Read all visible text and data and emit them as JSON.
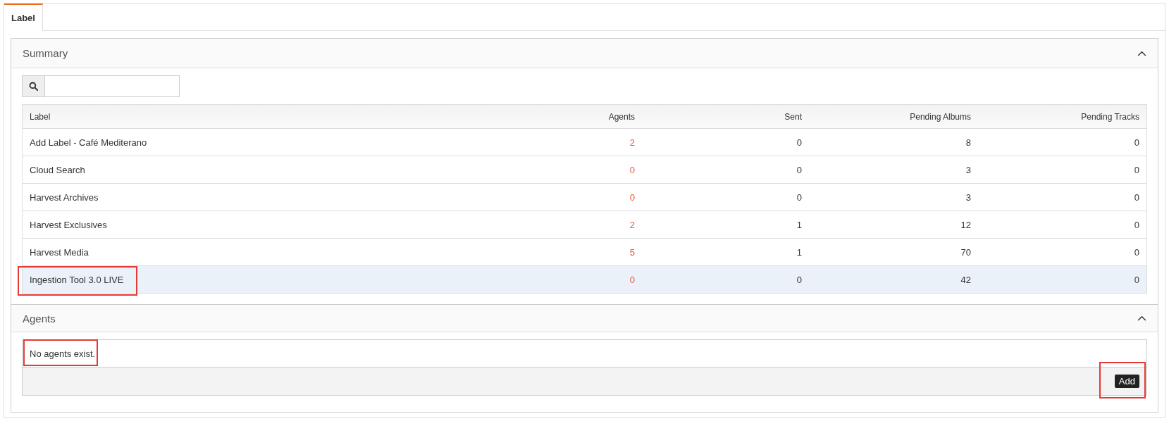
{
  "tabs": [
    {
      "label": "Label",
      "selected": true
    }
  ],
  "summary": {
    "title": "Summary",
    "expanded": true,
    "table": {
      "columns": [
        "Label",
        "Agents",
        "Sent",
        "Pending Albums",
        "Pending Tracks"
      ],
      "rows": [
        {
          "cells": [
            "Add Label - Café Mediterano",
            "2",
            "0",
            "8",
            "0"
          ],
          "selected": false,
          "annotated": false
        },
        {
          "cells": [
            "Cloud Search",
            "0",
            "0",
            "3",
            "0"
          ],
          "selected": false,
          "annotated": false
        },
        {
          "cells": [
            "Harvest Archives",
            "0",
            "0",
            "3",
            "0"
          ],
          "selected": false,
          "annotated": false
        },
        {
          "cells": [
            "Harvest Exclusives",
            "2",
            "1",
            "12",
            "0"
          ],
          "selected": false,
          "annotated": false
        },
        {
          "cells": [
            "Harvest Media",
            "5",
            "1",
            "70",
            "0"
          ],
          "selected": false,
          "annotated": false
        },
        {
          "cells": [
            "Ingestion Tool 3.0 LIVE",
            "0",
            "0",
            "42",
            "0"
          ],
          "selected": true,
          "annotated": true
        }
      ]
    }
  },
  "agents": {
    "title": "Agents",
    "expanded": true,
    "message": "No agents exist.",
    "message_annotated": true,
    "add_button": {
      "label": "Add",
      "annotated": true
    }
  }
}
